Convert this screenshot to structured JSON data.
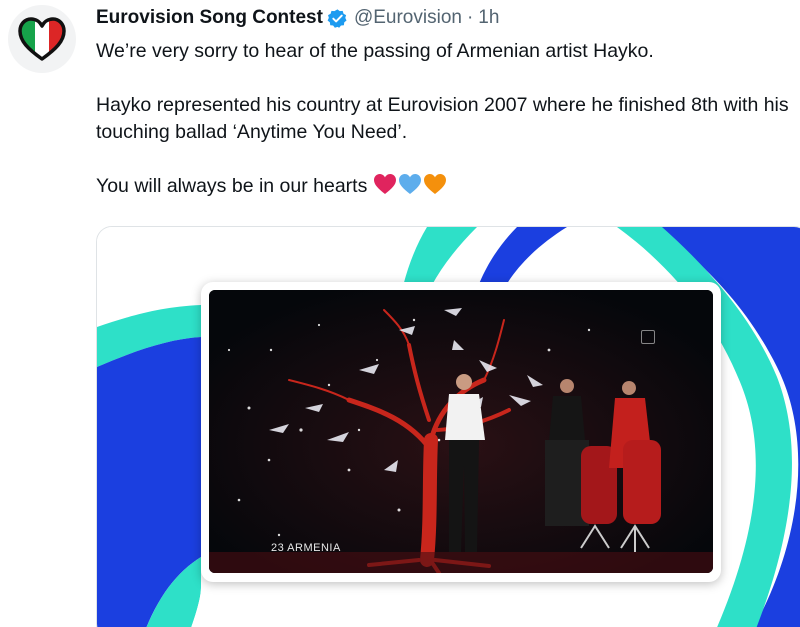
{
  "tweet": {
    "author_name": "Eurovision Song Contest",
    "handle": "@Eurovision",
    "separator": "·",
    "time": "1h",
    "avatar_icon": "eurovision-heart-logo",
    "verified_icon": "verified-badge-icon",
    "paragraphs": [
      "We’re very sorry to hear of the passing of Armenian artist Hayko.",
      "Hayko represented his country at Eurovision 2007 where he finished 8th with his touching ballad ‘Anytime You Need’.",
      "You will always be in our hearts"
    ],
    "hearts": [
      {
        "name": "red-heart-icon",
        "color": "#e0245e"
      },
      {
        "name": "blue-heart-icon",
        "color": "#5dadec"
      },
      {
        "name": "orange-heart-icon",
        "color": "#f4900c"
      }
    ]
  },
  "media": {
    "caption": "23  ARMENIA",
    "colors": {
      "teal": "#2ee0c8",
      "blue": "#1b3fe0",
      "tree": "#c8261c",
      "stage": "#07090d"
    }
  },
  "colors": {
    "verified": "#1d9bf0",
    "text_primary": "#0f1419",
    "text_secondary": "#536471"
  }
}
